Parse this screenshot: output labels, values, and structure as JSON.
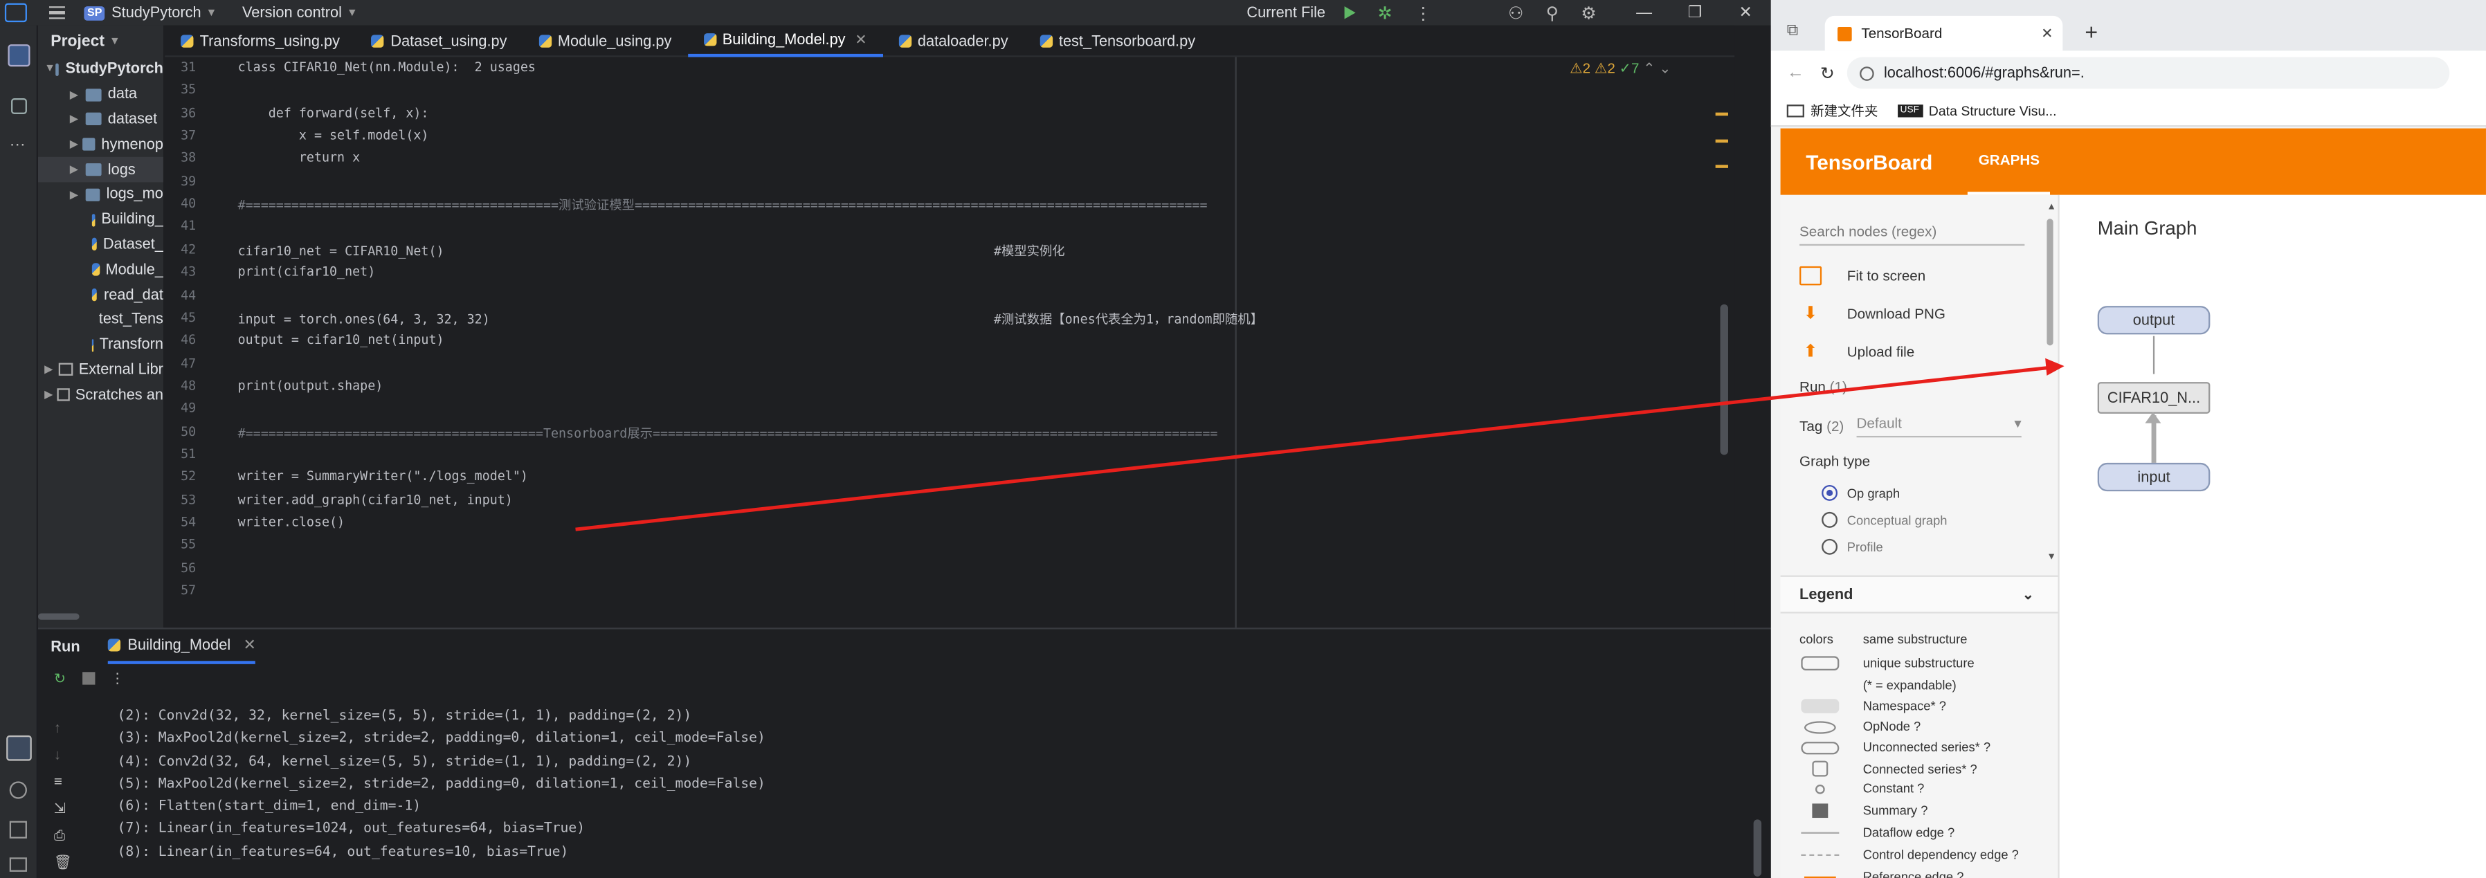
{
  "ide": {
    "project_badge": "SP",
    "project_name": "StudyPytorch",
    "version_control": "Version control",
    "run_config": "Current File",
    "project_panel_title": "Project",
    "tree": [
      {
        "label": "StudyPytorch",
        "kind": "root"
      },
      {
        "label": "data",
        "kind": "folder"
      },
      {
        "label": "dataset",
        "kind": "folder"
      },
      {
        "label": "hymenop",
        "kind": "folder"
      },
      {
        "label": "logs",
        "kind": "folder"
      },
      {
        "label": "logs_mo",
        "kind": "folder"
      },
      {
        "label": "Building_",
        "kind": "py"
      },
      {
        "label": "Dataset_",
        "kind": "py"
      },
      {
        "label": "Module_",
        "kind": "py"
      },
      {
        "label": "read_dat",
        "kind": "py"
      },
      {
        "label": "test_Tens",
        "kind": "py"
      },
      {
        "label": "Transforn",
        "kind": "py"
      },
      {
        "label": "External Libr",
        "kind": "lib"
      },
      {
        "label": "Scratches an",
        "kind": "scratch"
      }
    ],
    "tabs": [
      "Transforms_using.py",
      "Dataset_using.py",
      "Module_using.py",
      "Building_Model.py",
      "dataloader.py",
      "test_Tensorboard.py"
    ],
    "active_tab": "Building_Model.py",
    "inspections": {
      "warn1": "2",
      "warn2": "2",
      "ok": "7"
    },
    "code_lines": [
      {
        "n": "31",
        "t": "class CIFAR10_Net(nn.Module):  2 usages"
      },
      {
        "n": "35",
        "t": ""
      },
      {
        "n": "36",
        "t": "    def forward(self, x):"
      },
      {
        "n": "37",
        "t": "        x = self.model(x)"
      },
      {
        "n": "38",
        "t": "        return x"
      },
      {
        "n": "39",
        "t": ""
      },
      {
        "n": "40",
        "t": "#=========================================测试验证模型==========================================================================="
      },
      {
        "n": "41",
        "t": ""
      },
      {
        "n": "42",
        "t": "cifar10_net = CIFAR10_Net()                                                                        #模型实例化"
      },
      {
        "n": "43",
        "t": "print(cifar10_net)"
      },
      {
        "n": "44",
        "t": ""
      },
      {
        "n": "45",
        "t": "input = torch.ones(64, 3, 32, 32)                                                                  #测试数据【ones代表全为1，random即随机】"
      },
      {
        "n": "46",
        "t": "output = cifar10_net(input)"
      },
      {
        "n": "47",
        "t": ""
      },
      {
        "n": "48",
        "t": "print(output.shape)"
      },
      {
        "n": "49",
        "t": ""
      },
      {
        "n": "50",
        "t": "#=======================================Tensorboard展示=========================================================================="
      },
      {
        "n": "51",
        "t": ""
      },
      {
        "n": "52",
        "t": "writer = SummaryWriter(\"./logs_model\")"
      },
      {
        "n": "53",
        "t": "writer.add_graph(cifar10_net, input)"
      },
      {
        "n": "54",
        "t": "writer.close()"
      },
      {
        "n": "55",
        "t": ""
      },
      {
        "n": "56",
        "t": ""
      },
      {
        "n": "57",
        "t": ""
      }
    ],
    "run_label": "Run",
    "run_tab": "Building_Model",
    "console": [
      "(2): Conv2d(32, 32, kernel_size=(5, 5), stride=(1, 1), padding=(2, 2))",
      "(3): MaxPool2d(kernel_size=2, stride=2, padding=0, dilation=1, ceil_mode=False)",
      "(4): Conv2d(32, 64, kernel_size=(5, 5), stride=(1, 1), padding=(2, 2))",
      "(5): MaxPool2d(kernel_size=2, stride=2, padding=0, dilation=1, ceil_mode=False)",
      "(6): Flatten(start_dim=1, end_dim=-1)",
      "(7): Linear(in_features=1024, out_features=64, bias=True)",
      "(8): Linear(in_features=64, out_features=10, bias=True)"
    ]
  },
  "browser": {
    "tab_title": "TensorBoard",
    "url": "localhost:6006/#graphs&run=.",
    "bookmarks": [
      "新建文件夹",
      "Data Structure Visu..."
    ],
    "bookmark_badge": "USF",
    "brand": "TensorBoard",
    "nav": "GRAPHS",
    "search_placeholder": "Search nodes (regex)",
    "actions": [
      "Fit to screen",
      "Download PNG",
      "Upload file"
    ],
    "run_label": "Run",
    "run_count": "(1)",
    "tag_label": "Tag",
    "tag_count": "(2)",
    "tag_value": "Default",
    "graph_type_label": "Graph type",
    "graph_types": [
      "Op graph",
      "Conceptual graph",
      "Profile"
    ],
    "selected_graph_type": "Op graph",
    "legend_title": "Legend",
    "legend_header": [
      "colors",
      "same substructure"
    ],
    "legend_items": [
      "unique substructure",
      "(* = expandable)",
      "Namespace* ?",
      "OpNode ?",
      "Unconnected series* ?",
      "Connected series* ?",
      "Constant ?",
      "Summary ?",
      "Dataflow edge ?",
      "Control dependency edge ?",
      "Reference edge ?"
    ],
    "main_graph_title": "Main Graph",
    "nodes": [
      "output",
      "CIFAR10_N...",
      "input"
    ]
  },
  "colors": {
    "accent": "#f57c00",
    "arrow": "#e8201c",
    "ide_bg": "#1e1f22"
  }
}
